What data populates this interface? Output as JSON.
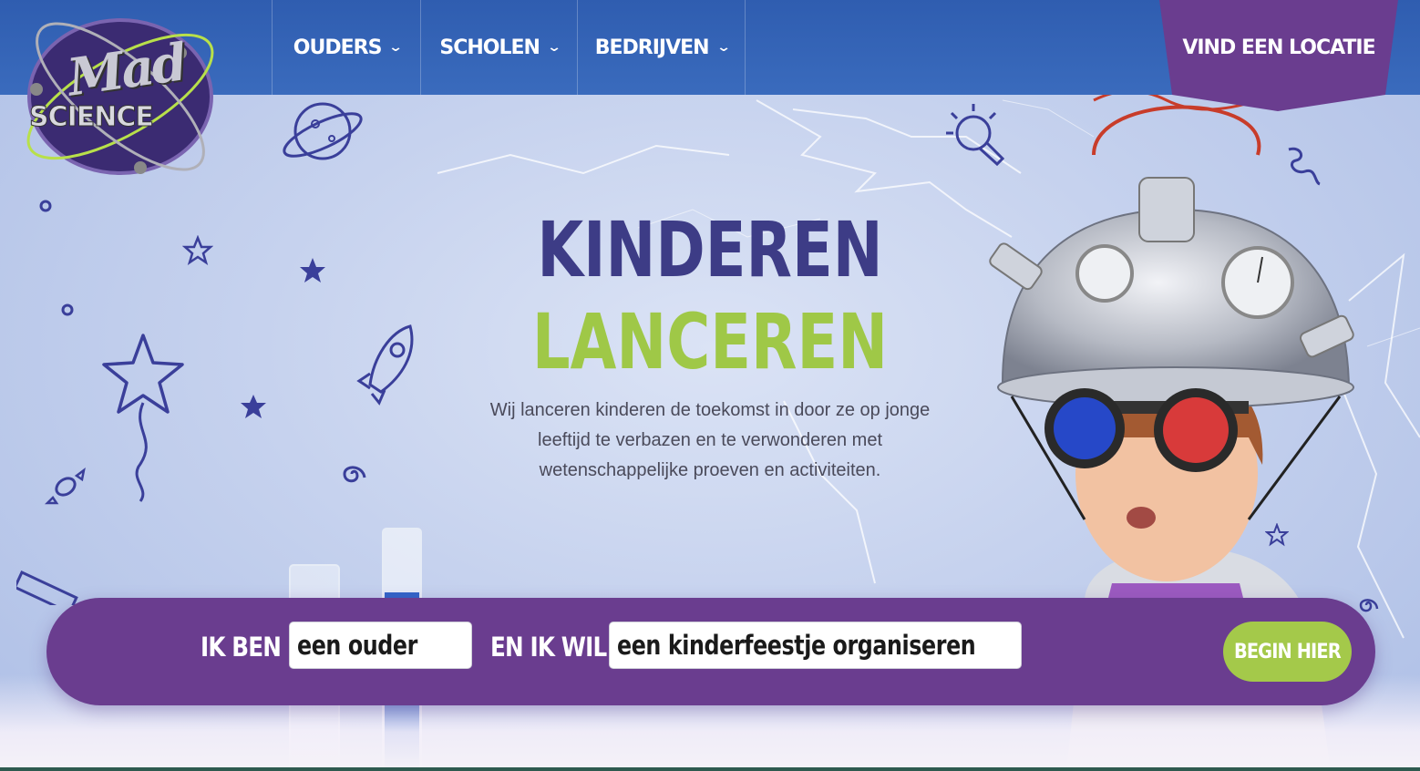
{
  "header": {
    "logo": {
      "line1": "Mad",
      "line2": "SCIENCE",
      "icon": "atom-logo"
    },
    "nav": [
      {
        "label": "OUDERS",
        "icon": "chevron-down-icon"
      },
      {
        "label": "SCHOLEN",
        "icon": "chevron-down-icon"
      },
      {
        "label": "BEDRIJVEN",
        "icon": "chevron-down-icon"
      }
    ],
    "cta": "VIND EEN LOCATIE"
  },
  "hero": {
    "title_line1": "KINDEREN",
    "title_line2": "LANCEREN",
    "intro": "Wij lanceren kinderen de toekomst in door ze op jonge leeftijd te verbazen en te verwonderen met wetenschappelijke proeven en activiteiten."
  },
  "search": {
    "label_1": "IK BEN",
    "value_1": "een ouder",
    "label_2": "EN IK WIL",
    "value_2": "een kinderfeestje organiseren",
    "button": "BEGIN HIER"
  },
  "colors": {
    "header_blue": "#3a6bbd",
    "purple": "#6a3d8f",
    "title_navy": "#3d3c86",
    "title_green": "#9fc847",
    "button_green": "#a4c94a"
  }
}
